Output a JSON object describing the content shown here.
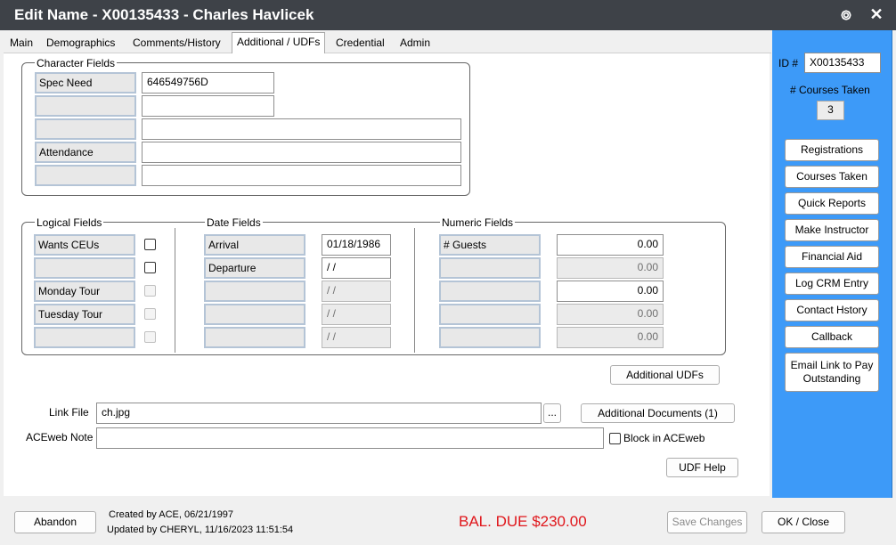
{
  "window": {
    "title": "Edit Name - X00135433 - Charles Havlicek",
    "gear_icon": "gear-icon",
    "close_glyph": "✕"
  },
  "tabs": [
    "Main",
    "Demographics",
    "Comments/History",
    "Additional / UDFs",
    "Credential",
    "Admin"
  ],
  "active_tab": "Additional / UDFs",
  "character_fields": {
    "title": "Character Fields",
    "rows": [
      {
        "label": "Spec Need",
        "value": "646549756D"
      },
      {
        "label": "",
        "value": ""
      },
      {
        "label": "",
        "value": ""
      },
      {
        "label": "Attendance",
        "value": ""
      },
      {
        "label": "",
        "value": ""
      }
    ]
  },
  "logical_fields": {
    "title": "Logical Fields",
    "rows": [
      {
        "label": "Wants CEUs",
        "checked": false,
        "enabled": true
      },
      {
        "label": "",
        "checked": false,
        "enabled": true
      },
      {
        "label": "Monday Tour",
        "checked": false,
        "enabled": false
      },
      {
        "label": "Tuesday Tour",
        "checked": false,
        "enabled": false
      },
      {
        "label": "",
        "checked": false,
        "enabled": false
      }
    ]
  },
  "date_fields": {
    "title": "Date Fields",
    "rows": [
      {
        "label": "Arrival",
        "value": "01/18/1986",
        "enabled": true
      },
      {
        "label": "Departure",
        "value": " /  /",
        "enabled": true
      },
      {
        "label": "",
        "value": " /  /",
        "enabled": false
      },
      {
        "label": "",
        "value": " /  /",
        "enabled": false
      },
      {
        "label": "",
        "value": " /  /",
        "enabled": false
      }
    ]
  },
  "numeric_fields": {
    "title": "Numeric Fields",
    "rows": [
      {
        "label": "# Guests",
        "value": "0.00",
        "enabled": true
      },
      {
        "label": "",
        "value": "0.00",
        "enabled": false
      },
      {
        "label": "",
        "value": "0.00",
        "enabled": true
      },
      {
        "label": "",
        "value": "0.00",
        "enabled": false
      },
      {
        "label": "",
        "value": "0.00",
        "enabled": false
      }
    ]
  },
  "additional_udfs_button": "Additional UDFs",
  "link_file": {
    "label": "Link File",
    "value": "ch.jpg",
    "browse": "..."
  },
  "additional_documents_button": "Additional Documents (1)",
  "aceweb_note": {
    "label": "ACEweb Note",
    "value": ""
  },
  "block_aceweb": {
    "label": "Block in ACEweb",
    "checked": false
  },
  "udf_help_button": "UDF Help",
  "side": {
    "id_label": "ID #",
    "id_value": "X00135433",
    "courses_label": "# Courses Taken",
    "courses_value": "3",
    "buttons": [
      "Registrations",
      "Courses Taken",
      "Quick Reports",
      "Make Instructor",
      "Financial Aid",
      "Log CRM Entry",
      "Contact Hstory",
      "Callback",
      "Email Link to Pay Outstanding"
    ]
  },
  "footer": {
    "abandon": "Abandon",
    "created": "Created by ACE, 06/21/1997",
    "updated": "Updated by CHERYL, 11/16/2023 11:51:54",
    "balance": "BAL. DUE $230.00",
    "save": "Save Changes",
    "ok_close": "OK / Close"
  },
  "colors": {
    "titlebar": "#3e4248",
    "side_panel": "#3d9af8",
    "balance": "#e0161b",
    "label_border": "#b4c4d6"
  }
}
